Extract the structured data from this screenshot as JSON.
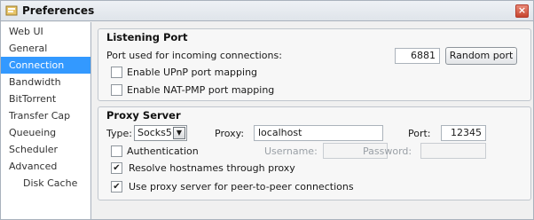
{
  "window": {
    "title": "Preferences",
    "close_glyph": "×"
  },
  "sidebar": {
    "items": [
      {
        "label": "Web UI",
        "active": false
      },
      {
        "label": "General",
        "active": false
      },
      {
        "label": "Connection",
        "active": true
      },
      {
        "label": "Bandwidth",
        "active": false
      },
      {
        "label": "BitTorrent",
        "active": false
      },
      {
        "label": "Transfer Cap",
        "active": false
      },
      {
        "label": "Queueing",
        "active": false
      },
      {
        "label": "Scheduler",
        "active": false
      },
      {
        "label": "Advanced",
        "active": false
      },
      {
        "label": "Disk Cache",
        "active": false
      }
    ],
    "active_color": "#3399ff"
  },
  "listening_port": {
    "title": "Listening Port",
    "port_label": "Port used for incoming connections:",
    "port_value": "6881",
    "random_port_label": "Random port",
    "upnp_label": "Enable UPnP port mapping",
    "upnp_checked": false,
    "natpmp_label": "Enable NAT-PMP port mapping",
    "natpmp_checked": false
  },
  "proxy_server": {
    "title": "Proxy Server",
    "type_label": "Type:",
    "type_value": "Socks5",
    "proxy_label": "Proxy:",
    "proxy_value": "localhost",
    "port_label": "Port:",
    "port_value": "12345",
    "auth_label": "Authentication",
    "auth_checked": false,
    "username_label": "Username:",
    "username_value": "",
    "password_label": "Password:",
    "password_value": "",
    "resolve_label": "Resolve hostnames through proxy",
    "resolve_checked": true,
    "p2p_label": "Use proxy server for peer-to-peer connections",
    "p2p_checked": true,
    "check_glyph": "✔",
    "dropdown_glyph": "▼"
  }
}
